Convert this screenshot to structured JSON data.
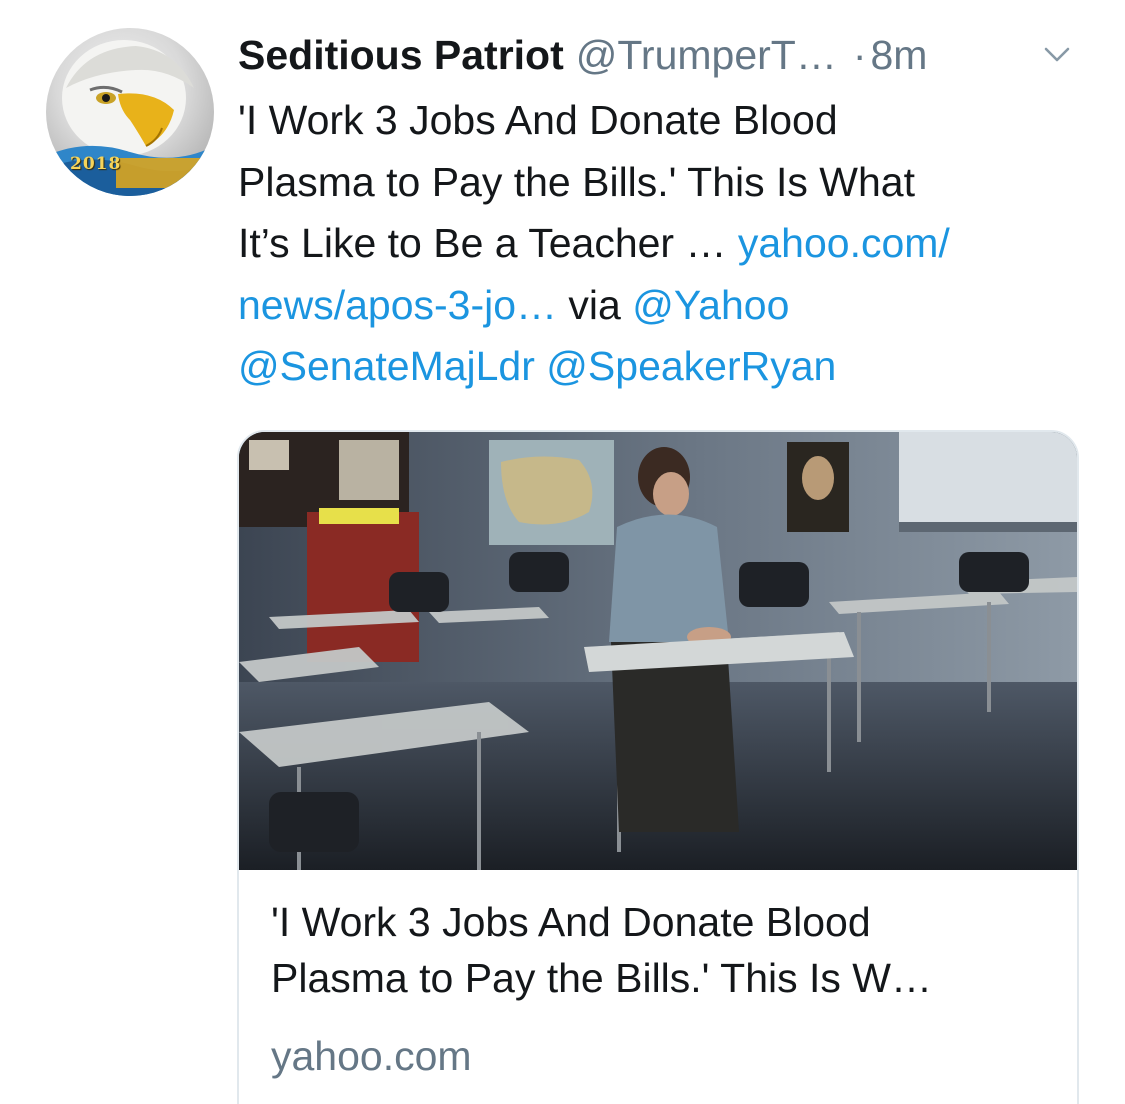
{
  "tweet": {
    "display_name": "Seditious Patriot",
    "handle": "@TrumperT…",
    "separator": "·",
    "time": "8m",
    "avatar_icon": "bald-eagle-avatar",
    "avatar_text": "2018",
    "text_lines": {
      "line1": "'I Work 3 Jobs And Donate Blood",
      "line2": "Plasma to Pay the Bills.' This Is What",
      "line3_text": "It’s Like to Be a Teacher … ",
      "line3_link": "yahoo.com/",
      "line4_link": "news/apos-3-jo…",
      "line4_via": " via ",
      "mention_yahoo": "@Yahoo",
      "mention_senate": "@SenateMajLdr",
      "mention_speaker": "@SpeakerRyan"
    },
    "link_color": "#1b95e0",
    "secondary_color": "#657786"
  },
  "card": {
    "image_icon": "classroom-teacher-photo",
    "title_line1": "'I Work 3 Jobs And Donate Blood",
    "title_line2": "Plasma to Pay the Bills.' This Is W…",
    "domain": "yahoo.com"
  }
}
